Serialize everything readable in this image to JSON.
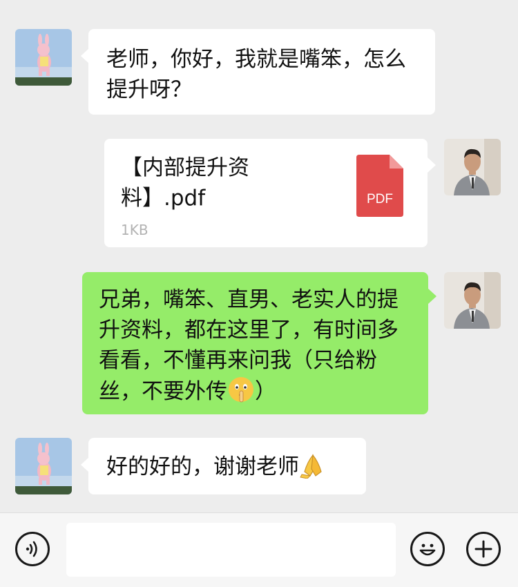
{
  "messages": [
    {
      "sender": "other",
      "text": "老师，你好，我就是嘴笨，怎么提升呀？"
    },
    {
      "sender": "self",
      "type": "file",
      "file_name": "【内部提升资料】.pdf",
      "file_size": "1KB",
      "file_badge": "PDF"
    },
    {
      "sender": "self",
      "text": "兄弟，嘴笨、直男、老实人的提升资料，都在这里了，有时间多看看，不懂再来问我（只给粉丝，不要外传",
      "text_end": "）",
      "emoji": "shushing-face"
    },
    {
      "sender": "other",
      "text": "好的好的，谢谢老师",
      "emoji": "folded-hands"
    }
  ],
  "input": {
    "value": "",
    "placeholder": ""
  },
  "colors": {
    "background": "#ededed",
    "own_bubble": "#95ec69",
    "other_bubble": "#ffffff",
    "pdf_badge": "#e04b4b",
    "file_size_text": "#b2b2b2"
  },
  "icons": {
    "voice": "voice-icon",
    "emoji": "emoji-icon",
    "more": "plus-icon"
  }
}
